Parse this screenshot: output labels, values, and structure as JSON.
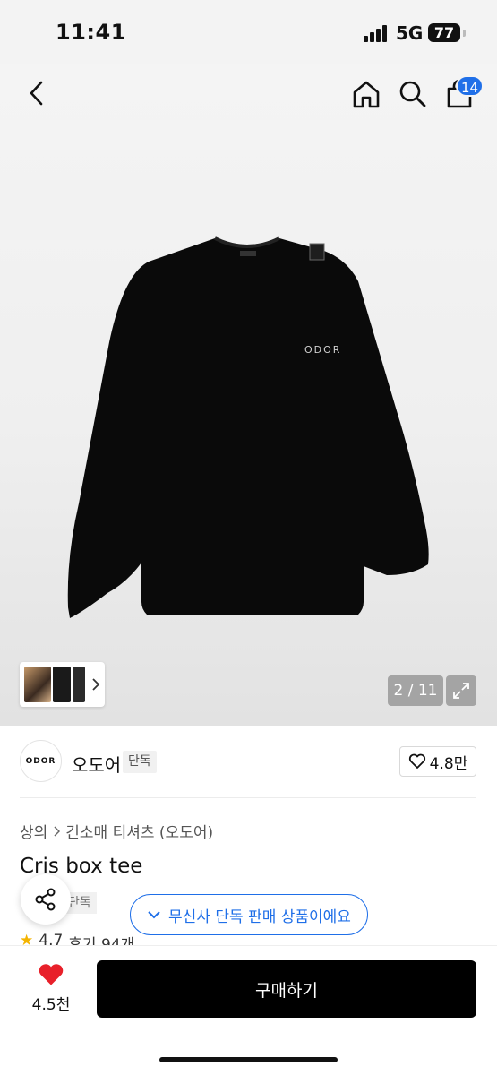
{
  "status_bar": {
    "time": "11:41",
    "network": "5G",
    "battery": "77"
  },
  "nav": {
    "cart_count": "14"
  },
  "gallery": {
    "counter": "2 / 11",
    "logo_text": "ODOR"
  },
  "brand": {
    "logo": "ODOR",
    "name": "오도어",
    "tag": "단독",
    "likes": "4.8만"
  },
  "breadcrumb": {
    "category": "상의",
    "subcategory": "긴소매 티셔츠 (오도어)"
  },
  "product": {
    "title": "Cris box tee",
    "tag": "단독",
    "exclusive_notice": "무신사 단독 판매 상품이에요",
    "rating": "4.7",
    "reviews": "후기 94개"
  },
  "bottom": {
    "wish_count": "4.5천",
    "buy_label": "구매하기"
  },
  "colors": {
    "accent": "#1f6fe8",
    "heart": "#e8202a",
    "star": "#f4b400"
  }
}
